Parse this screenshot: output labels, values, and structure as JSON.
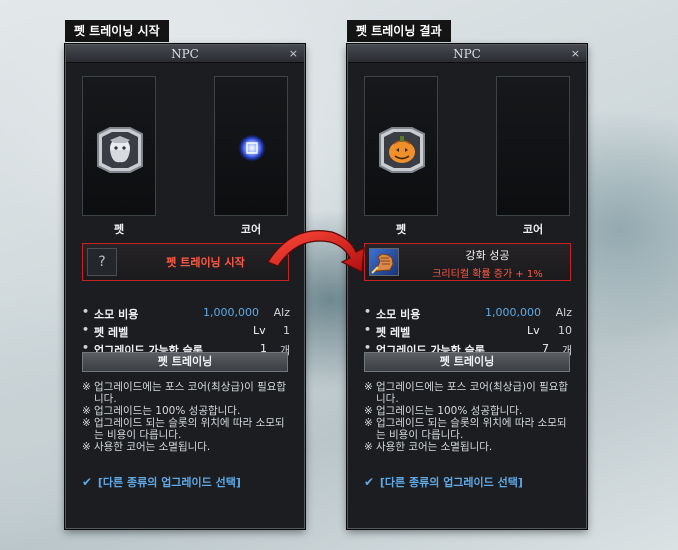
{
  "start": {
    "caption": "펫 트레이닝 시작",
    "window_title": "NPC",
    "close_glyph": "×",
    "slot_pet_label": "펫",
    "slot_core_label": "코어",
    "question_mark": "?",
    "action_text": "펫 트레이닝 시작",
    "stats": [
      {
        "label": "소모 비용",
        "value": "1,000,000",
        "unit": "Alz"
      },
      {
        "label": "펫 레벨",
        "value": "Lv",
        "unit": "1"
      },
      {
        "label": "업그레이드 가능한 슬롯",
        "value": "1",
        "unit": "개"
      }
    ],
    "train_button": "펫 트레이닝",
    "notes": [
      {
        "mark": "※",
        "text": "업그레이드에는 포스 코어(최상급)이 필요합니다."
      },
      {
        "mark": "※",
        "text": "업그레이드는 100% 성공합니다."
      },
      {
        "mark": "※",
        "text": "업그레이드 되는 슬롯의 위치에 따라 소모되는 비용이 다릅니다."
      },
      {
        "mark": "※",
        "text": "사용한 코어는 소멸됩니다."
      }
    ],
    "select_link": "[다른 종류의 업그레이드 선택]"
  },
  "result": {
    "caption": "펫 트레이닝 결과",
    "window_title": "NPC",
    "close_glyph": "×",
    "slot_pet_label": "펫",
    "slot_core_label": "코어",
    "result_title": "강화 성공",
    "result_effect": "크리티컬 확률 증가 + 1%",
    "stats": [
      {
        "label": "소모 비용",
        "value": "1,000,000",
        "unit": "Alz"
      },
      {
        "label": "펫 레벨",
        "value": "Lv",
        "unit": "10"
      },
      {
        "label": "업그레이드 가능한 슬롯",
        "value": "7",
        "unit": "개"
      }
    ],
    "train_button": "펫 트레이닝",
    "notes": [
      {
        "mark": "※",
        "text": "업그레이드에는 포스 코어(최상급)이 필요합니다."
      },
      {
        "mark": "※",
        "text": "업그레이드는 100% 성공합니다."
      },
      {
        "mark": "※",
        "text": "업그레이드 되는 슬롯의 위치에 따라 소모되는 비용이 다릅니다."
      },
      {
        "mark": "※",
        "text": "사용한 코어는 소멸됩니다."
      }
    ],
    "select_link": "[다른 종류의 업그레이드 선택]"
  },
  "colors": {
    "accent_red": "#ff5a44",
    "border_red": "#c42424",
    "link_blue": "#5fa9e6",
    "cost_blue": "#5fa9e6"
  },
  "icons": {
    "pet_start": "ghost-pet-icon",
    "core": "force-core-icon",
    "pet_result": "pumpkin-pet-icon",
    "result": "fist-icon",
    "arrow": "curved-red-arrow"
  }
}
